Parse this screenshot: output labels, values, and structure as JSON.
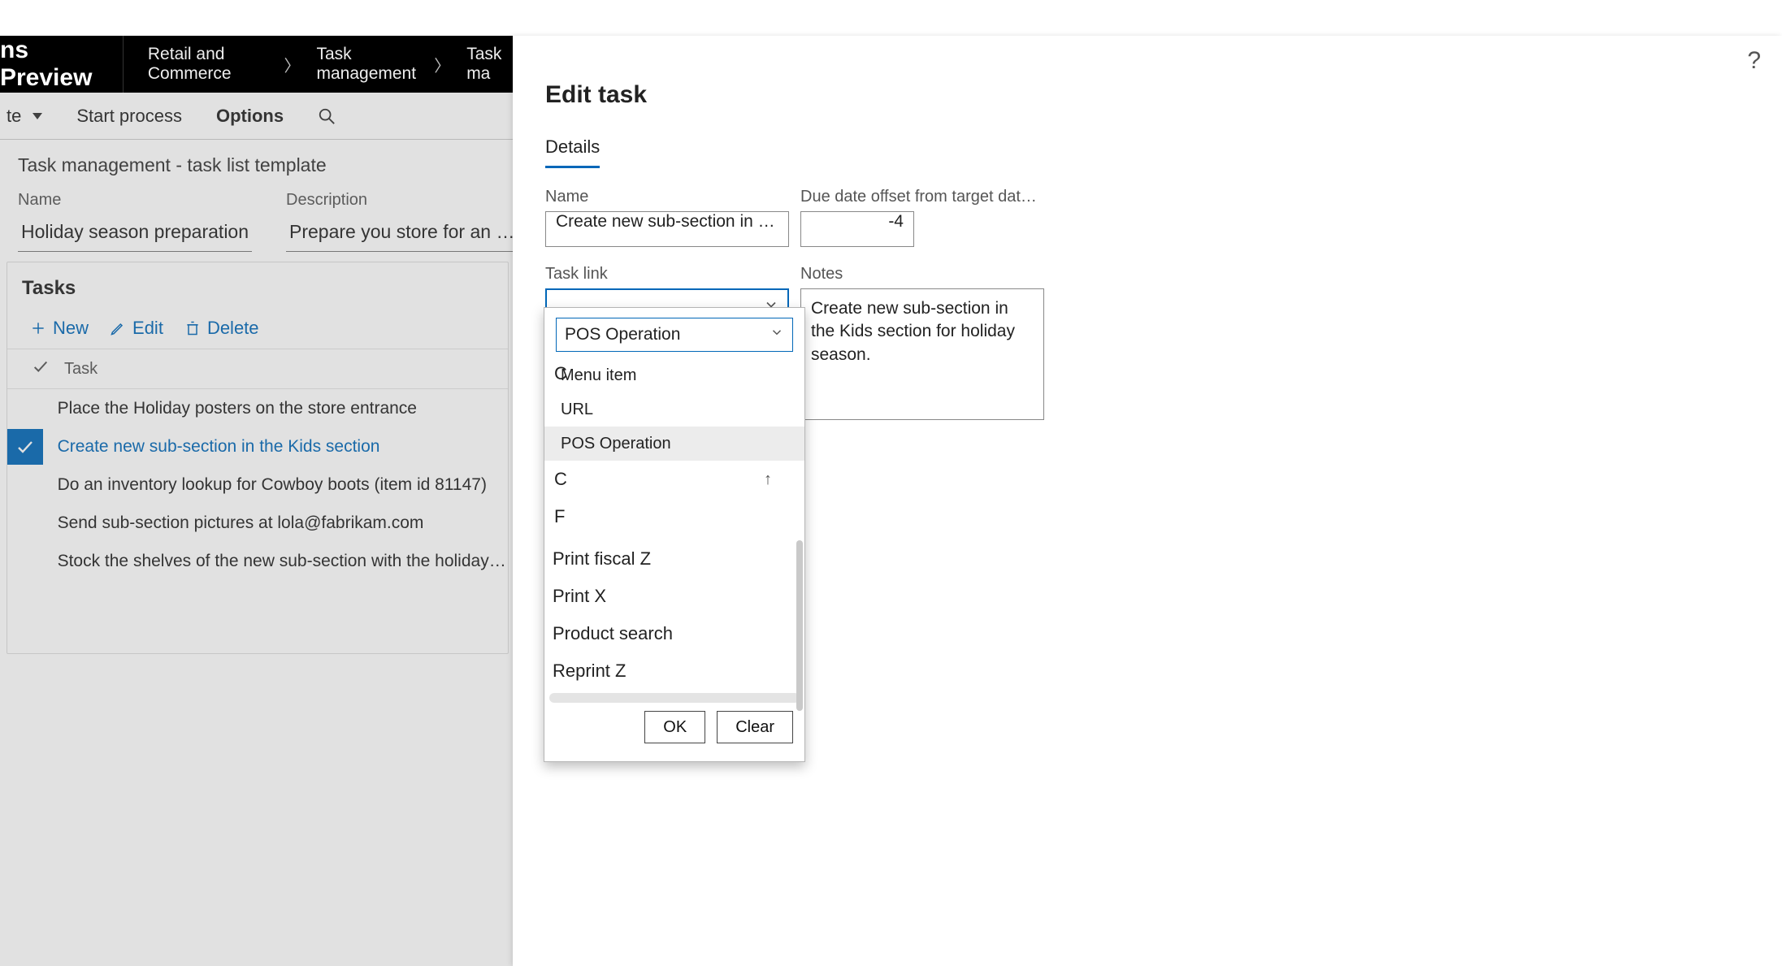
{
  "topbar": {
    "title_fragment": "ns Preview",
    "crumbs": [
      "Retail and Commerce",
      "Task management",
      "Task ma"
    ]
  },
  "actionbar": {
    "item0": "te",
    "start_process": "Start process",
    "options": "Options"
  },
  "page": {
    "title": "Task management - task list template",
    "name_label": "Name",
    "name_value": "Holiday season preparation",
    "desc_label": "Description",
    "desc_value": "Prepare you store for an upcom…"
  },
  "tasks": {
    "card_title": "Tasks",
    "new_label": "New",
    "edit_label": "Edit",
    "delete_label": "Delete",
    "col_task": "Task",
    "rows": [
      {
        "text": "Place the Holiday posters on the store entrance",
        "selected": false
      },
      {
        "text": "Create new sub-section in the Kids section",
        "selected": true
      },
      {
        "text": "Do an inventory lookup for Cowboy boots (item id 81147)",
        "selected": false
      },
      {
        "text": "Send sub-section pictures at lola@fabrikam.com",
        "selected": false
      },
      {
        "text": "Stock the shelves of the new sub-section with the holiday dr",
        "selected": false
      }
    ]
  },
  "panel": {
    "title": "Edit task",
    "tab": "Details",
    "name_label": "Name",
    "name_value": "Create new sub-section in the K…",
    "due_label": "Due date offset from target date (+/- …",
    "due_value": "-4",
    "tasklink_label": "Task link",
    "notes_label": "Notes",
    "notes_value": "Create new sub-section in the Kids section for holiday season."
  },
  "dropdown": {
    "type_value": "POS Operation",
    "type_options": [
      "Menu item",
      "URL",
      "POS Operation"
    ],
    "hovered_index": 2,
    "peek0": "C",
    "peek1": "C",
    "peek2": "F",
    "list": [
      "Print fiscal Z",
      "Print X",
      "Product search",
      "Reprint Z"
    ],
    "sort_glyph": "↑",
    "ok": "OK",
    "clear": "Clear"
  }
}
